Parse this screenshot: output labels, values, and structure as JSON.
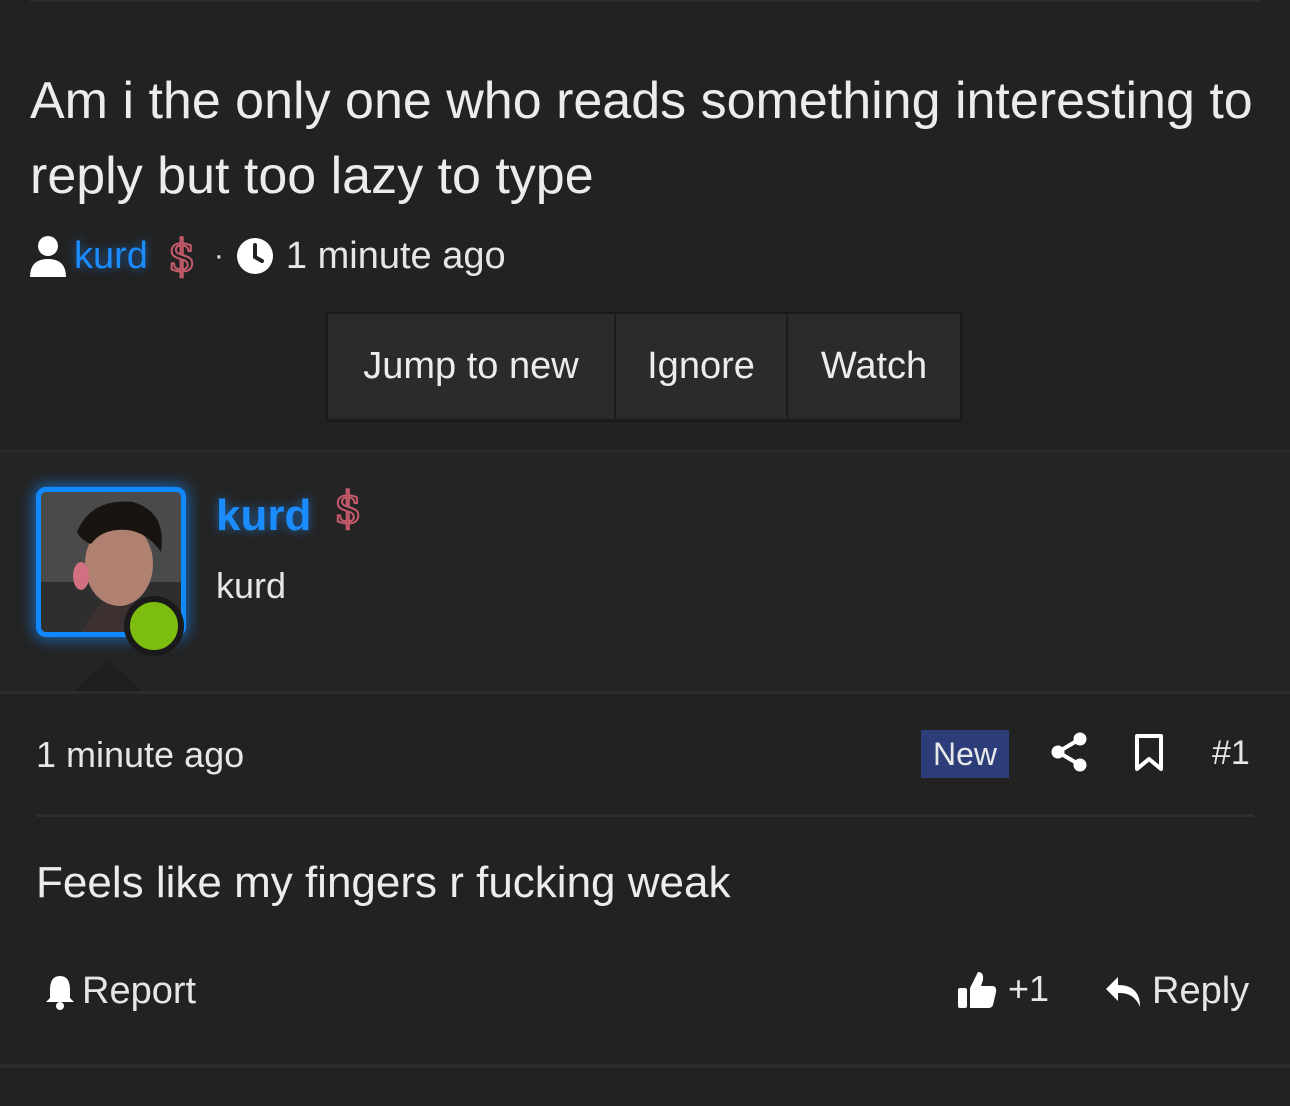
{
  "thread": {
    "title": "Am i the only one who reads something interesting to reply but too lazy to type",
    "author": "kurd",
    "separator": "·",
    "time": "1 minute ago"
  },
  "actions": {
    "jump_label": "Jump to new",
    "ignore_label": "Ignore",
    "watch_label": "Watch"
  },
  "post": {
    "username": "kurd",
    "user_title": "kurd",
    "time": "1 minute ago",
    "badge": "New",
    "number": "#1",
    "body": "Feels like my fingers r fucking weak",
    "report_label": "Report",
    "like_label": "+1",
    "reply_label": "Reply",
    "online": true
  },
  "colors": {
    "background": "#222222",
    "username": "#1a8cff",
    "online": "#7dbd10",
    "badge": "#2d3d7a"
  },
  "icons": [
    "user-icon",
    "dollar-icon",
    "clock-icon",
    "share-icon",
    "bookmark-icon",
    "bell-icon",
    "thumbs-up-icon",
    "reply-icon"
  ]
}
